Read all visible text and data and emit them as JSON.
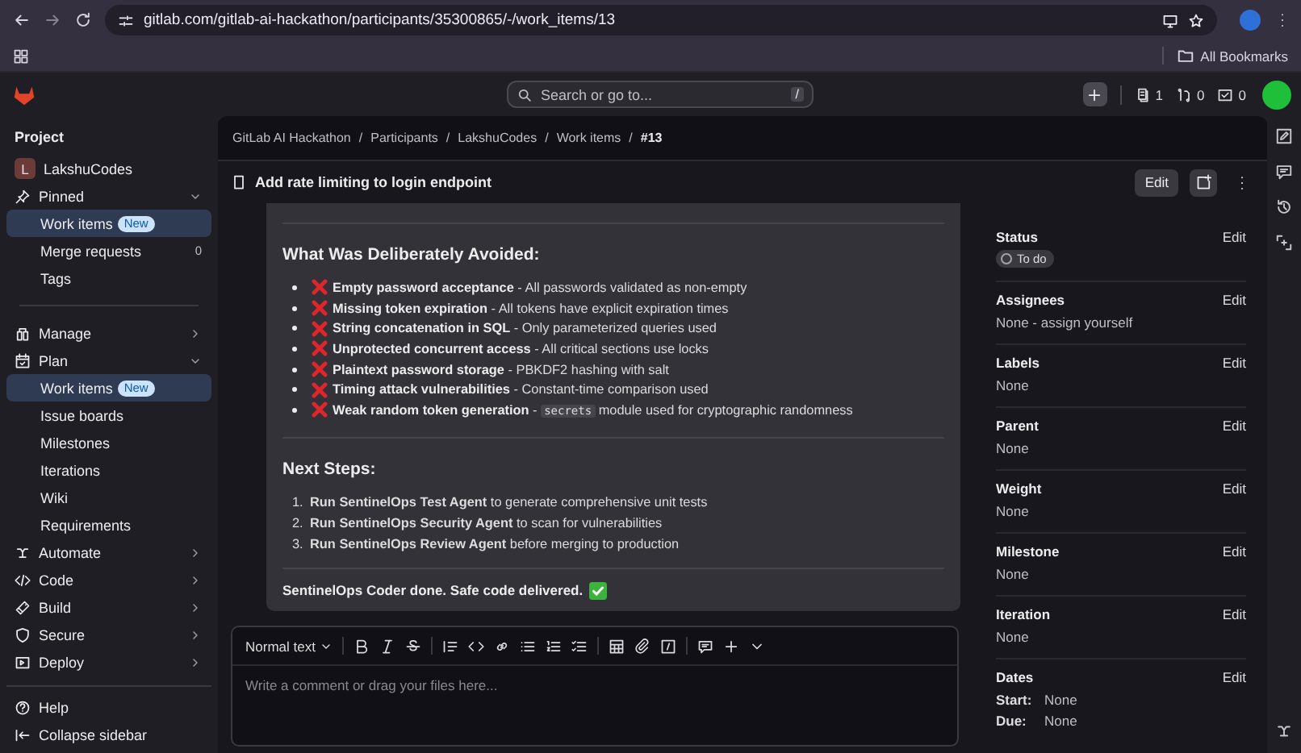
{
  "browser": {
    "url": "gitlab.com/gitlab-ai-hackathon/participants/35300865/-/work_items/13",
    "bookmarks_label": "All Bookmarks"
  },
  "header": {
    "search_placeholder": "Search or go to...",
    "shortcut": "/",
    "issues_count": "1",
    "merge_requests_count": "0",
    "todos_count": "0"
  },
  "sidebar": {
    "heading": "Project",
    "project": {
      "initial": "L",
      "name": "LakshuCodes"
    },
    "groups": [
      {
        "label": "Pinned",
        "expanded": true,
        "items": [
          {
            "label": "Work items",
            "badge": "New",
            "selected": true
          },
          {
            "label": "Merge requests",
            "count": "0",
            "selected": false
          },
          {
            "label": "Tags",
            "selected": false
          }
        ]
      },
      {
        "label": "Manage",
        "expanded": false
      },
      {
        "label": "Plan",
        "expanded": true,
        "items": [
          {
            "label": "Work items",
            "badge": "New",
            "selected": true
          },
          {
            "label": "Issue boards",
            "selected": false
          },
          {
            "label": "Milestones",
            "selected": false
          },
          {
            "label": "Iterations",
            "selected": false
          },
          {
            "label": "Wiki",
            "selected": false
          },
          {
            "label": "Requirements",
            "selected": false
          }
        ]
      },
      {
        "label": "Automate",
        "expanded": false
      },
      {
        "label": "Code",
        "expanded": false
      },
      {
        "label": "Build",
        "expanded": false
      },
      {
        "label": "Secure",
        "expanded": false
      },
      {
        "label": "Deploy",
        "expanded": false
      }
    ],
    "footer": [
      {
        "label": "Help"
      },
      {
        "label": "Collapse sidebar"
      }
    ]
  },
  "breadcrumbs": [
    {
      "kind": "link",
      "label": "GitLab AI Hackathon"
    },
    {
      "kind": "separator",
      "label": "/"
    },
    {
      "kind": "link",
      "label": "Participants"
    },
    {
      "kind": "separator",
      "label": "/"
    },
    {
      "kind": "link",
      "label": "LakshuCodes"
    },
    {
      "kind": "separator",
      "label": "/"
    },
    {
      "kind": "link",
      "label": "Work items"
    },
    {
      "kind": "separator",
      "label": "/"
    },
    {
      "kind": "current",
      "label": "#13"
    }
  ],
  "work_item": {
    "title": "Add rate limiting to login endpoint",
    "edit_button": "Edit"
  },
  "description": {
    "avoided_heading": "What Was Deliberately Avoided:",
    "avoided": [
      {
        "parts": [
          {
            "kind": "bold",
            "text": "Empty password acceptance"
          },
          {
            "kind": "plain",
            "text": " - All passwords validated as non-empty"
          }
        ]
      },
      {
        "parts": [
          {
            "kind": "bold",
            "text": "Missing token expiration"
          },
          {
            "kind": "plain",
            "text": " - All tokens have explicit expiration times"
          }
        ]
      },
      {
        "parts": [
          {
            "kind": "bold",
            "text": "String concatenation in SQL"
          },
          {
            "kind": "plain",
            "text": " - Only parameterized queries used"
          }
        ]
      },
      {
        "parts": [
          {
            "kind": "bold",
            "text": "Unprotected concurrent access"
          },
          {
            "kind": "plain",
            "text": " - All critical sections use locks"
          }
        ]
      },
      {
        "parts": [
          {
            "kind": "bold",
            "text": "Plaintext password storage"
          },
          {
            "kind": "plain",
            "text": " - PBKDF2 hashing with salt"
          }
        ]
      },
      {
        "parts": [
          {
            "kind": "bold",
            "text": "Timing attack vulnerabilities"
          },
          {
            "kind": "plain",
            "text": " - Constant-time comparison used"
          }
        ]
      },
      {
        "parts": [
          {
            "kind": "bold",
            "text": "Weak random token generation"
          },
          {
            "kind": "plain",
            "text": " - "
          },
          {
            "kind": "code",
            "text": "secrets"
          },
          {
            "kind": "plain",
            "text": " module used for cryptographic randomness"
          }
        ]
      }
    ],
    "next_heading": "Next Steps:",
    "next_steps": [
      {
        "number": "1.",
        "text": "**Run SentinelOps Test Agent** to generate comprehensive unit tests"
      },
      {
        "number": "2.",
        "text": "**Run SentinelOps Security Agent** to scan for vulnerabilities"
      },
      {
        "number": "3.",
        "text": "**Run SentinelOps Review Agent** before merging to production"
      }
    ],
    "closing": "SentinelOps Coder done. Safe code delivered."
  },
  "comment_editor": {
    "text_style": "Normal text",
    "placeholder": "Write a comment or drag your files here..."
  },
  "attributes": [
    {
      "kind": "badge",
      "label": "Status",
      "edit": "Edit",
      "value": "To do"
    },
    {
      "kind": "text",
      "label": "Assignees",
      "edit": "Edit",
      "value": "None - assign yourself"
    },
    {
      "kind": "text",
      "label": "Labels",
      "edit": "Edit",
      "value": "None"
    },
    {
      "kind": "text",
      "label": "Parent",
      "edit": "Edit",
      "value": "None"
    },
    {
      "kind": "text",
      "label": "Weight",
      "edit": "Edit",
      "value": "None"
    },
    {
      "kind": "text",
      "label": "Milestone",
      "edit": "Edit",
      "value": "None"
    },
    {
      "kind": "text",
      "label": "Iteration",
      "edit": "Edit",
      "value": "None"
    },
    {
      "kind": "dates",
      "label": "Dates",
      "edit": "Edit",
      "lines": [
        {
          "label": "Start:",
          "value": "None"
        },
        {
          "label": "Due:",
          "value": "None"
        }
      ]
    }
  ]
}
